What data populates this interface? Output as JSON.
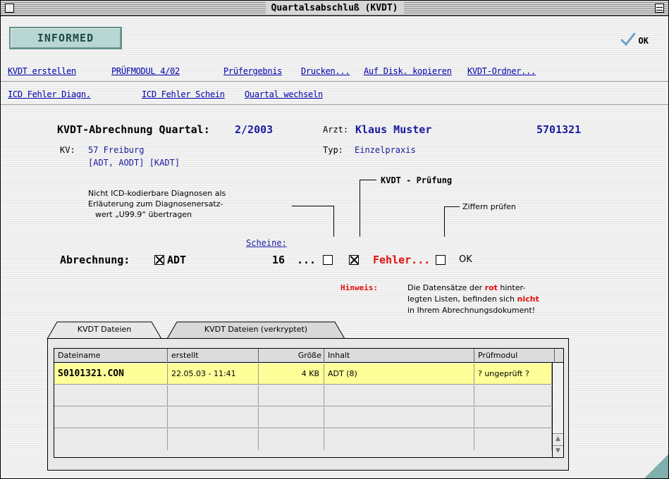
{
  "window": {
    "title": "Quartalsabschluß (KVDT)"
  },
  "logo": "INFORMED",
  "ok_button": "OK",
  "menu_row1": [
    "KVDT erstellen",
    "PRÜFMODUL 4/02",
    "Prüfergebnis",
    "Drucken...",
    "Auf Disk. kopieren",
    "KVDT-Ordner..."
  ],
  "menu_row2": [
    "ICD Fehler Diagn.",
    "ICD Fehler Schein",
    "Quartal wechseln"
  ],
  "header": {
    "heading": "KVDT-Abrechnung Quartal:",
    "quartal": "2/2003",
    "arzt_label": "Arzt:",
    "arzt_name": "Klaus Muster",
    "arzt_nr": "5701321",
    "kv_label": "KV:",
    "kv_value": "57 Freiburg",
    "kv_types": "[ADT, AODT] [KADT]",
    "typ_label": "Typ:",
    "typ_value": "Einzelpraxis"
  },
  "annotations": {
    "icd_note_1": "Nicht ICD-kodierbare Diagnosen als",
    "icd_note_2": "Erläuterung zum Diagnosenersatz-",
    "icd_note_3": "wert „U99.9“ übertragen",
    "kvdt_pruefung": "KVDT - Prüfung",
    "ziffern_pruefen": "Ziffern prüfen",
    "scheine_link": "Scheine:"
  },
  "abrechnung": {
    "label": "Abrechnung:",
    "adt_label": "ADT",
    "adt_checked": true,
    "count": "16",
    "ellipsis": "...",
    "icd_checked": false,
    "kvdt_checked": true,
    "fehler_label": "Fehler...",
    "ziffern_checked": false,
    "ok_label": "OK"
  },
  "hinweis": {
    "label": "Hinweis:",
    "line1_a": "Die Datensätze der",
    "line1_red": "rot",
    "line1_b": "hinter-",
    "line2_a": "legten Listen, befinden sich",
    "line2_red": "nicht",
    "line3": "in Ihrem Abrechnungsdokument!"
  },
  "tabs": [
    "KVDT Dateien",
    "KVDT Dateien (verkryptet)"
  ],
  "table": {
    "columns": [
      "Dateiname",
      "erstellt",
      "Größe",
      "Inhalt",
      "Prüfmodul"
    ],
    "rows": [
      [
        "S0101321.CON",
        "22.05.03 - 11:41",
        "4 KB",
        "ADT (8)",
        "? ungeprüft ?"
      ]
    ]
  },
  "colors": {
    "link": "#0000aa",
    "error": "#e01010",
    "highlight_row": "#ffff99",
    "logo_bg": "#b9d7d2"
  }
}
